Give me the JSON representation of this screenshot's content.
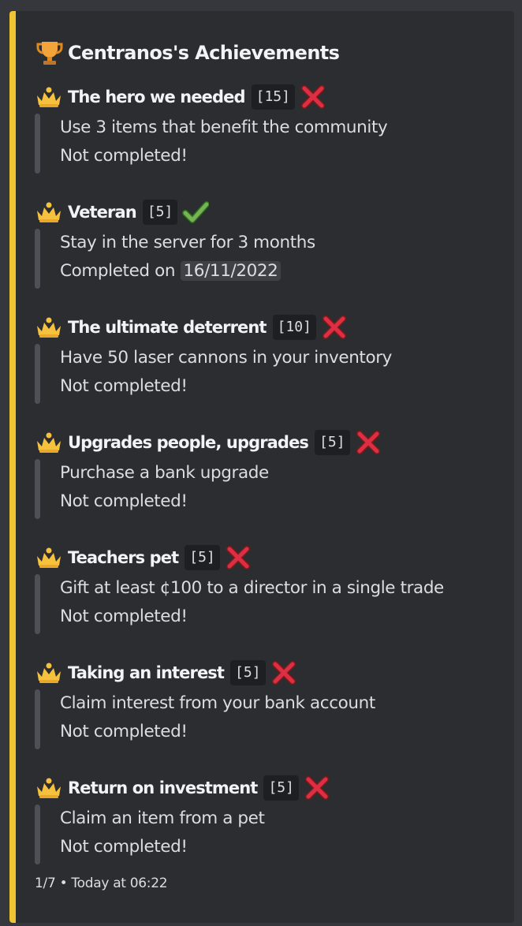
{
  "embed": {
    "accent_color": "#f0c330",
    "title_icon": "trophy-icon",
    "title": "Centranos's Achievements"
  },
  "achievements": [
    {
      "icon": "crown-icon",
      "name": "The hero we needed",
      "points": "[15]",
      "status": "cross",
      "description": "Use 3 items that benefit the community",
      "status_text": "Not completed!"
    },
    {
      "icon": "crown-icon",
      "name": "Veteran",
      "points": "[5]",
      "status": "check",
      "description": "Stay in the server for 3 months",
      "status_text": "Completed on ",
      "date": "16/11/2022"
    },
    {
      "icon": "crown-icon",
      "name": "The ultimate deterrent",
      "points": "[10]",
      "status": "cross",
      "description": "Have 50 laser cannons in your inventory",
      "status_text": "Not completed!"
    },
    {
      "icon": "crown-icon",
      "name": "Upgrades people, upgrades",
      "points": "[5]",
      "status": "cross",
      "description": "Purchase a bank upgrade",
      "status_text": "Not completed!"
    },
    {
      "icon": "crown-icon",
      "name": "Teachers pet",
      "points": "[5]",
      "status": "cross",
      "description": "Gift at least ¢100 to a director in a single trade",
      "status_text": "Not completed!"
    },
    {
      "icon": "crown-icon",
      "name": "Taking an interest",
      "points": "[5]",
      "status": "cross",
      "description": "Claim interest from your bank account",
      "status_text": "Not completed!"
    },
    {
      "icon": "crown-icon",
      "name": "Return on investment",
      "points": "[5]",
      "status": "cross",
      "description": "Claim an item from a pet",
      "status_text": "Not completed!"
    }
  ],
  "footer": {
    "page": "1/7",
    "separator": "•",
    "timestamp": "Today at 06:22"
  }
}
